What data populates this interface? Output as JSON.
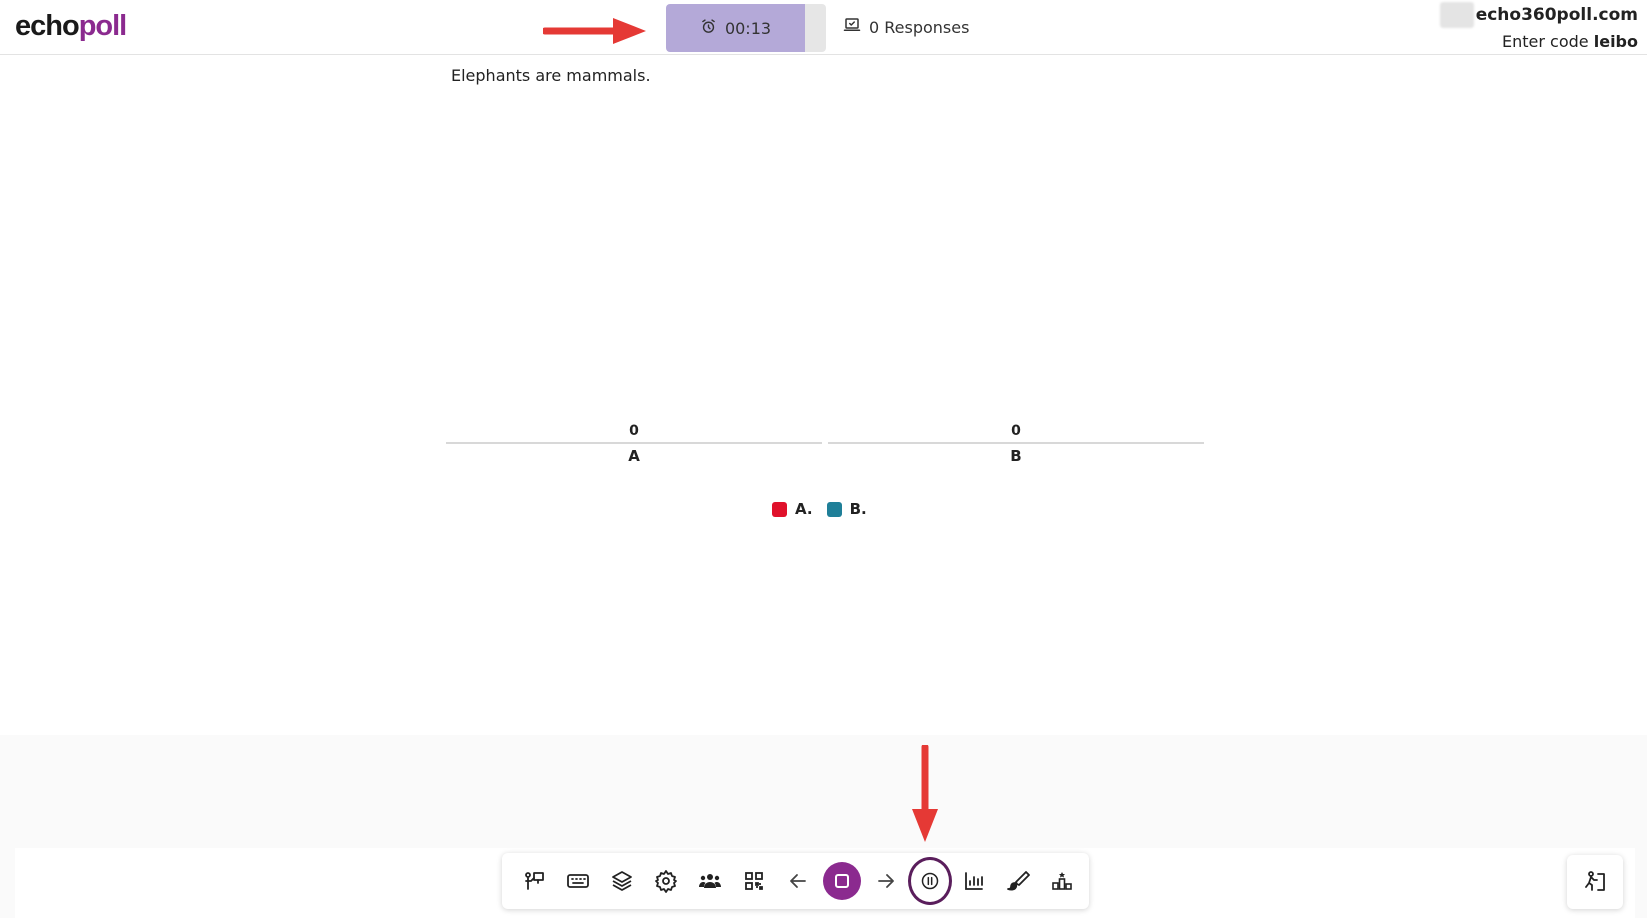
{
  "header": {
    "logo_part1": "echo",
    "logo_part2": "poll",
    "timer": "00:13",
    "timer_progress_fraction": 0.87,
    "responses": "0 Responses",
    "host": "echo360poll.com",
    "code_prefix": "Enter code",
    "code_value": "leibo"
  },
  "question": {
    "text": "Elephants are mammals."
  },
  "chart_data": {
    "type": "bar",
    "categories": [
      "A",
      "B"
    ],
    "values": [
      0,
      0
    ],
    "value_labels": [
      "0",
      "0"
    ],
    "legend": [
      {
        "label": "A.",
        "color": "#e0112b"
      },
      {
        "label": "B.",
        "color": "#1f7f98"
      }
    ],
    "legend_placement": "bottom-center",
    "grid": false
  },
  "toolbar": {
    "icons": [
      "presenter-icon",
      "keyboard-icon",
      "layers-icon",
      "settings-icon",
      "participants-icon",
      "qr-code-icon",
      "previous-arrow-icon",
      "stop-icon",
      "next-arrow-icon",
      "pause-icon",
      "bar-chart-icon",
      "brush-icon",
      "leaderboard-icon"
    ]
  },
  "exit": {
    "icon": "exit-presentation-icon"
  },
  "colors": {
    "brand": "#8b2a8f",
    "timer_fill": "#b4a9d8",
    "annotation_arrow": "#e53935"
  }
}
